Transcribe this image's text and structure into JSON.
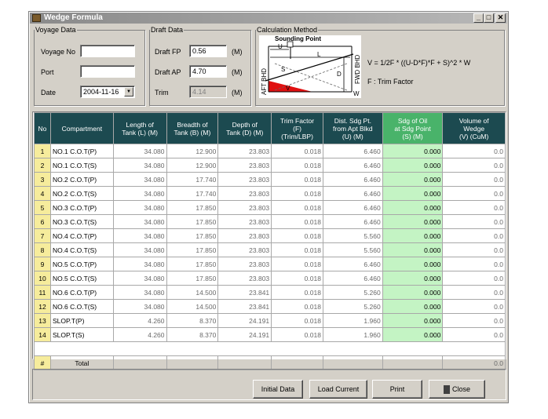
{
  "window": {
    "title": "Wedge Formula",
    "controls": {
      "minimize": "_",
      "maximize": "□",
      "close": "✕"
    }
  },
  "voyage": {
    "legend": "Voyage Data",
    "voyage_no_label": "Voyage No",
    "voyage_no_value": "",
    "port_label": "Port",
    "port_value": "",
    "date_label": "Date",
    "date_value": "2004-11-16"
  },
  "draft": {
    "legend": "Draft Data",
    "fp_label": "Draft FP",
    "fp_value": "0.56",
    "ap_label": "Draft AP",
    "ap_value": "4.70",
    "trim_label": "Trim",
    "trim_value": "4.14",
    "unit": "(M)"
  },
  "calc": {
    "legend": "Calculation Method",
    "diagram_label_sounding": "Sounding Point",
    "diagram_label_u": "U",
    "diagram_label_l": "L",
    "diagram_label_s": "S",
    "diagram_label_d": "D",
    "diagram_label_v": "V",
    "diagram_label_w": "W",
    "diagram_label_aft": "AFT BHD",
    "diagram_label_fwd": "FWD BHD",
    "formula": "V = 1/2F * ((U-D*F)*F + S)^2 * W",
    "note": "F : Trim Factor"
  },
  "table": {
    "headers": [
      [
        "No"
      ],
      [
        "Compartment"
      ],
      [
        "Length of",
        "Tank (L) (M)"
      ],
      [
        "Breadth of",
        "Tank (B) (M)"
      ],
      [
        "Depth of",
        "Tank (D) (M)"
      ],
      [
        "Trim Factor",
        "(F)",
        "(Trim/LBP)"
      ],
      [
        "Dist. Sdg Pt.",
        "from Apt Blkd",
        "(U) (M)"
      ],
      [
        "Sdg of Oil",
        "at Sdg Point",
        "(S) (M)"
      ],
      [
        "Volume of",
        "Wedge",
        "(V) (CuM)"
      ]
    ],
    "rows": [
      [
        "1",
        "NO.1 C.O.T(P)",
        "34.080",
        "12.900",
        "23.803",
        "0.018",
        "6.460",
        "0.000",
        "0.0"
      ],
      [
        "2",
        "NO.1 C.O.T(S)",
        "34.080",
        "12.900",
        "23.803",
        "0.018",
        "6.460",
        "0.000",
        "0.0"
      ],
      [
        "3",
        "NO.2 C.O.T(P)",
        "34.080",
        "17.740",
        "23.803",
        "0.018",
        "6.460",
        "0.000",
        "0.0"
      ],
      [
        "4",
        "NO.2 C.O.T(S)",
        "34.080",
        "17.740",
        "23.803",
        "0.018",
        "6.460",
        "0.000",
        "0.0"
      ],
      [
        "5",
        "NO.3 C.O.T(P)",
        "34.080",
        "17.850",
        "23.803",
        "0.018",
        "6.460",
        "0.000",
        "0.0"
      ],
      [
        "6",
        "NO.3 C.O.T(S)",
        "34.080",
        "17.850",
        "23.803",
        "0.018",
        "6.460",
        "0.000",
        "0.0"
      ],
      [
        "7",
        "NO.4 C.O.T(P)",
        "34.080",
        "17.850",
        "23.803",
        "0.018",
        "5.560",
        "0.000",
        "0.0"
      ],
      [
        "8",
        "NO.4 C.O.T(S)",
        "34.080",
        "17.850",
        "23.803",
        "0.018",
        "5.560",
        "0.000",
        "0.0"
      ],
      [
        "9",
        "NO.5 C.O.T(P)",
        "34.080",
        "17.850",
        "23.803",
        "0.018",
        "6.460",
        "0.000",
        "0.0"
      ],
      [
        "10",
        "NO.5 C.O.T(S)",
        "34.080",
        "17.850",
        "23.803",
        "0.018",
        "6.460",
        "0.000",
        "0.0"
      ],
      [
        "11",
        "NO.6 C.O.T(P)",
        "34.080",
        "14.500",
        "23.841",
        "0.018",
        "5.260",
        "0.000",
        "0.0"
      ],
      [
        "12",
        "NO.6 C.O.T(S)",
        "34.080",
        "14.500",
        "23.841",
        "0.018",
        "5.260",
        "0.000",
        "0.0"
      ],
      [
        "13",
        "SLOP.T(P)",
        "4.260",
        "8.370",
        "24.191",
        "0.018",
        "1.960",
        "0.000",
        "0.0"
      ],
      [
        "14",
        "SLOP.T(S)",
        "4.260",
        "8.370",
        "24.191",
        "0.018",
        "1.960",
        "0.000",
        "0.0"
      ]
    ],
    "total": {
      "no": "#",
      "label": "Total",
      "value": "0.0"
    }
  },
  "buttons": {
    "initial_data": "Initial Data",
    "load_current": "Load Current",
    "print": "Print",
    "close": "Close"
  },
  "colors": {
    "header_dark": "#1c4a50",
    "header_green": "#49b36a",
    "green_cell": "#c4f4c4",
    "no_cell": "#f6ec9c"
  }
}
